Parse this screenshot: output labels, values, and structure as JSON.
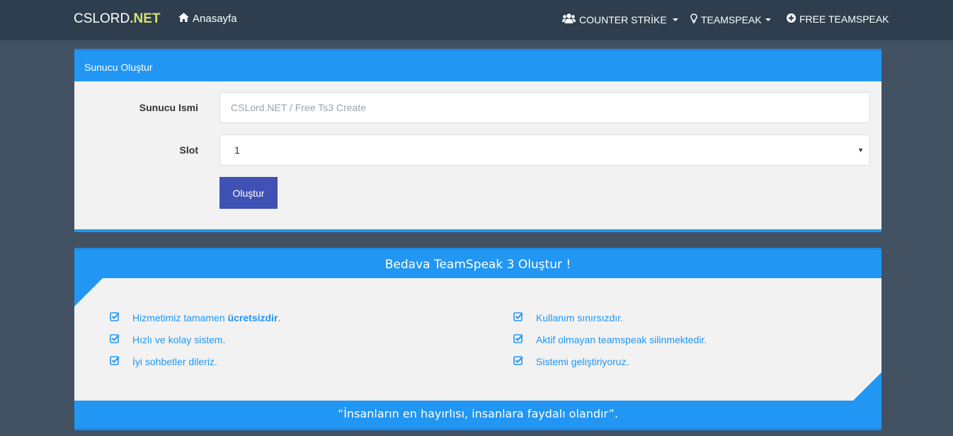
{
  "navbar": {
    "brand_main": "CSLORD",
    "brand_accent": ".NET",
    "home_label": "Anasayfa",
    "cs_label": "COUNTER STRİKE",
    "ts_label": "TEAMSPEAK",
    "free_label": "FREE TEAMSPEAK"
  },
  "create_panel": {
    "title": "Sunucu Oluştur",
    "name_label": "Sunucu Ismi",
    "name_placeholder": "CSLord.NET / Free Ts3 Create",
    "slot_label": "Slot",
    "slot_value": "1",
    "submit_label": "Oluştur"
  },
  "info_panel": {
    "title": "Bedava TeamSpeak 3 Oluştur !",
    "features_left": [
      {
        "text": "Hizmetimiz tamamen ",
        "bold": "ücretsizdir",
        "suffix": "."
      },
      {
        "text": "Hızlı ve kolay sistem."
      },
      {
        "text": "İyi sohbetler dileriz."
      }
    ],
    "features_right": [
      {
        "text": "Kullanım sınırsızdır."
      },
      {
        "text": "Aktif olmayan teamspeak silinmektedir."
      },
      {
        "text": "Sistemi geliştiriyoruz."
      }
    ],
    "quote": "“İnsanların en hayırlısı, insanlara faydalı olandır”."
  },
  "colors": {
    "navbar_bg": "#2e3e4e",
    "page_bg": "#435263",
    "accent_blue": "#2196f3",
    "button_indigo": "#3f51b5",
    "brand_accent": "#d7e36a"
  },
  "icons": {
    "home": "home-icon",
    "cs": "users-icon",
    "ts": "lightbulb-icon",
    "free": "plus-circle-icon",
    "check": "check-square-icon"
  }
}
